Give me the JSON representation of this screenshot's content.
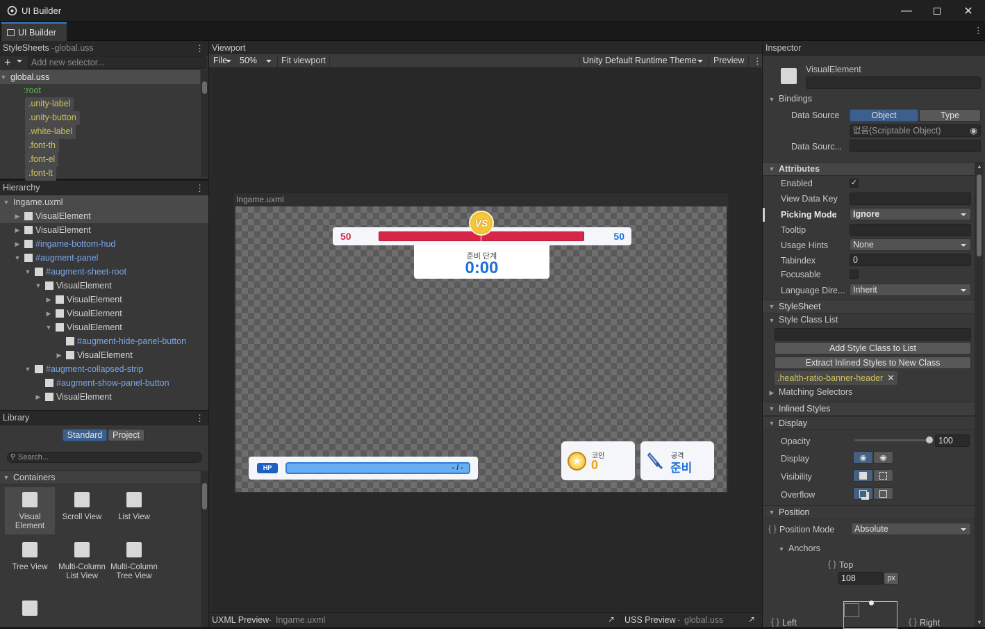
{
  "window": {
    "title": "UI Builder",
    "tab": "UI Builder"
  },
  "stylesheets": {
    "title": "StyleSheets",
    "file": "global.uss",
    "selector_placeholder": "Add new selector...",
    "root_file": "global.uss",
    "selectors": [
      ":root",
      ".unity-label",
      ".unity-button",
      ".white-label",
      ".font-th",
      ".font-el",
      ".font-lt"
    ]
  },
  "hierarchy": {
    "title": "Hierarchy",
    "root": "Ingame.uxml",
    "rows": [
      {
        "label": "VisualElement"
      },
      {
        "label": "VisualElement"
      },
      {
        "label": "#ingame-bottom-hud"
      },
      {
        "label": "#augment-panel"
      },
      {
        "label": "#augment-sheet-root"
      },
      {
        "label": "VisualElement"
      },
      {
        "label": "VisualElement"
      },
      {
        "label": "VisualElement"
      },
      {
        "label": "VisualElement"
      },
      {
        "label": "#augment-hide-panel-button"
      },
      {
        "label": "VisualElement"
      },
      {
        "label": "#augment-collapsed-strip"
      },
      {
        "label": "#augment-show-panel-button"
      },
      {
        "label": "VisualElement"
      }
    ]
  },
  "library": {
    "title": "Library",
    "tab_standard": "Standard",
    "tab_project": "Project",
    "search_placeholder": "Search...",
    "group": "Containers",
    "tiles": [
      "Visual Element",
      "Scroll View",
      "List View",
      "Tree View",
      "Multi-Column List View",
      "Multi-Column Tree View"
    ]
  },
  "viewport": {
    "title": "Viewport",
    "file_menu": "File",
    "zoom": "50%",
    "fit": "Fit viewport",
    "theme": "Unity Default Runtime Theme",
    "preview": "Preview",
    "canvas_title": "Ingame.uxml"
  },
  "game": {
    "left_score": "50",
    "right_score": "50",
    "vs": "VS",
    "phase_label": "준비 단계",
    "timer": "0:00",
    "hp_badge": "HP",
    "hp_text": "- / -",
    "coin_label": "코인",
    "coin_value": "0",
    "attack_label": "공격",
    "attack_value": "준비"
  },
  "bottom": {
    "uxml_preview": "UXML Preview",
    "uxml_file": "Ingame.uxml",
    "uss_preview": "USS Preview",
    "uss_file": "global.uss"
  },
  "inspector": {
    "title": "Inspector",
    "element_type": "VisualElement",
    "bindings": "Bindings",
    "data_source_label": "Data Source",
    "data_source_object": "Object",
    "data_source_type": "Type",
    "data_source_value": "없음(Scriptable Object)",
    "data_source_path_label": "Data Sourc...",
    "attributes": "Attributes",
    "enabled_label": "Enabled",
    "view_data_key_label": "View Data Key",
    "picking_mode_label": "Picking Mode",
    "picking_mode_value": "Ignore",
    "tooltip_label": "Tooltip",
    "usage_hints_label": "Usage Hints",
    "usage_hints_value": "None",
    "tabindex_label": "Tabindex",
    "tabindex_value": "0",
    "focusable_label": "Focusable",
    "language_direction_label": "Language Dire...",
    "language_direction_value": "Inherit",
    "stylesheet": "StyleSheet",
    "style_class_list": "Style Class List",
    "add_style_class": "Add Style Class to List",
    "extract_inlined": "Extract Inlined Styles to New Class",
    "class_tag": ".health-ratio-banner-header",
    "matching_selectors": "Matching Selectors",
    "inlined_styles": "Inlined Styles",
    "display_section": "Display",
    "opacity_label": "Opacity",
    "opacity_value": "100",
    "opacity_level": 1.0,
    "display_label": "Display",
    "visibility_label": "Visibility",
    "overflow_label": "Overflow",
    "position_section": "Position",
    "position_mode_label": "Position Mode",
    "position_mode_value": "Absolute",
    "anchors_label": "Anchors",
    "top_label": "Top",
    "top_value": "108",
    "top_unit": "px",
    "left_label": "Left",
    "right_label": "Right"
  },
  "colors": {
    "accent_blue": "#3a79bb",
    "selector_yellow": "#cfc25a",
    "hp_red": "#d7264a",
    "score_blue": "#1e6fd9",
    "score_red": "#d7264a"
  }
}
